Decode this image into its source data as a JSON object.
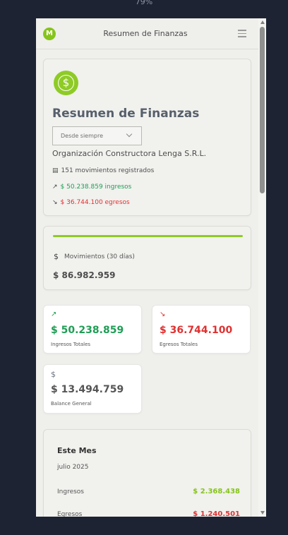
{
  "browser": {
    "zoom": "79%"
  },
  "header": {
    "logo_letter": "M",
    "title": "Resumen de Finanzas",
    "menu_icon": "hamburger-icon"
  },
  "summary": {
    "icon": "dollar-circle-icon",
    "title": "Resumen de Finanzas",
    "period_select": {
      "selected": "Desde siempre"
    },
    "organization": "Organización Constructora Lenga S.R.L.",
    "movements_count": "151 movimientos registrados",
    "income_text": "$ 50.238.859 ingresos",
    "expense_text": "$ 36.744.100 egresos"
  },
  "movements_30d": {
    "label": "Movimientos (30 días)",
    "value": "$ 86.982.959"
  },
  "stats": {
    "income": {
      "value": "$ 50.238.859",
      "label": "Ingresos Totales"
    },
    "expenses": {
      "value": "$ 36.744.100",
      "label": "Egresos Totales"
    },
    "balance": {
      "value": "$ 13.494.759",
      "label": "Balance General"
    }
  },
  "month": {
    "title": "Este Mes",
    "subtitle": "julio 2025",
    "rows": [
      {
        "label": "Ingresos",
        "value": "$ 2.368.438"
      },
      {
        "label": "Egresos",
        "value": "$ 1.240.501"
      }
    ]
  },
  "colors": {
    "brand_green": "#8ecb25",
    "income_green": "#1f9d55",
    "expense_red": "#e03131",
    "month_income": "#86c41b",
    "balance_gray": "#555555"
  }
}
